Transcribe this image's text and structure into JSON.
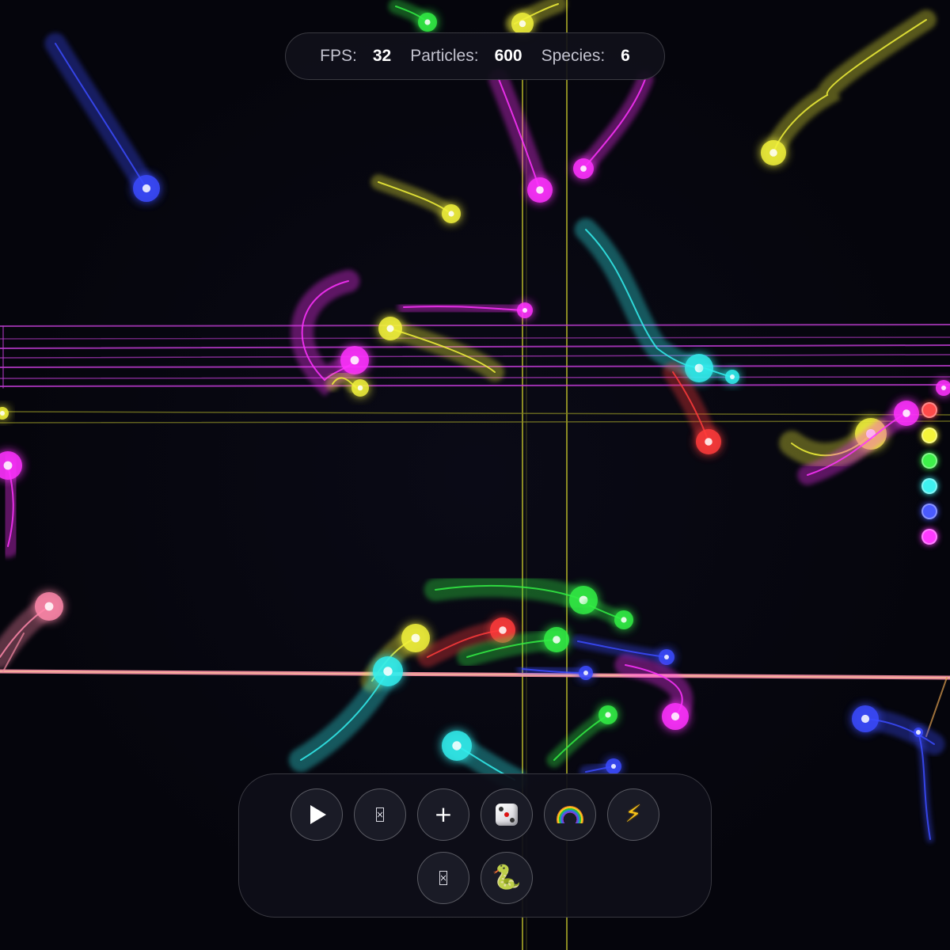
{
  "stats": {
    "fps_label": "FPS:",
    "fps_value": "32",
    "particles_label": "Particles:",
    "particles_value": "600",
    "species_label": "Species:",
    "species_value": "6"
  },
  "species_colors": [
    "#ff4a4a",
    "#f4f43a",
    "#3ef04a",
    "#3ef0f0",
    "#4a5aff",
    "#ff3aff"
  ],
  "controls": {
    "row1": [
      {
        "name": "play-button",
        "icon": "play-icon",
        "label": ""
      },
      {
        "name": "missing-glyph-button",
        "icon": "missing-glyph-icon",
        "label": ""
      },
      {
        "name": "add-species-button",
        "icon": "plus-icon",
        "label": "+"
      },
      {
        "name": "randomize-button",
        "icon": "dice-icon",
        "label": ""
      },
      {
        "name": "rainbow-button",
        "icon": "rainbow-icon",
        "label": ""
      },
      {
        "name": "energy-button",
        "icon": "lightning-icon",
        "label": "⚡"
      }
    ],
    "row2": [
      {
        "name": "missing-glyph-button-2",
        "icon": "missing-glyph-icon",
        "label": ""
      },
      {
        "name": "snake-button",
        "icon": "snake-icon",
        "label": "🐍"
      }
    ]
  },
  "scene": {
    "colors": {
      "red": "#ff3b3b",
      "yellow": "#f2f23a",
      "green": "#33ee44",
      "cyan": "#33eeee",
      "blue": "#3b4bff",
      "magenta": "#ff33ff",
      "pink": "#ff88aa"
    }
  }
}
